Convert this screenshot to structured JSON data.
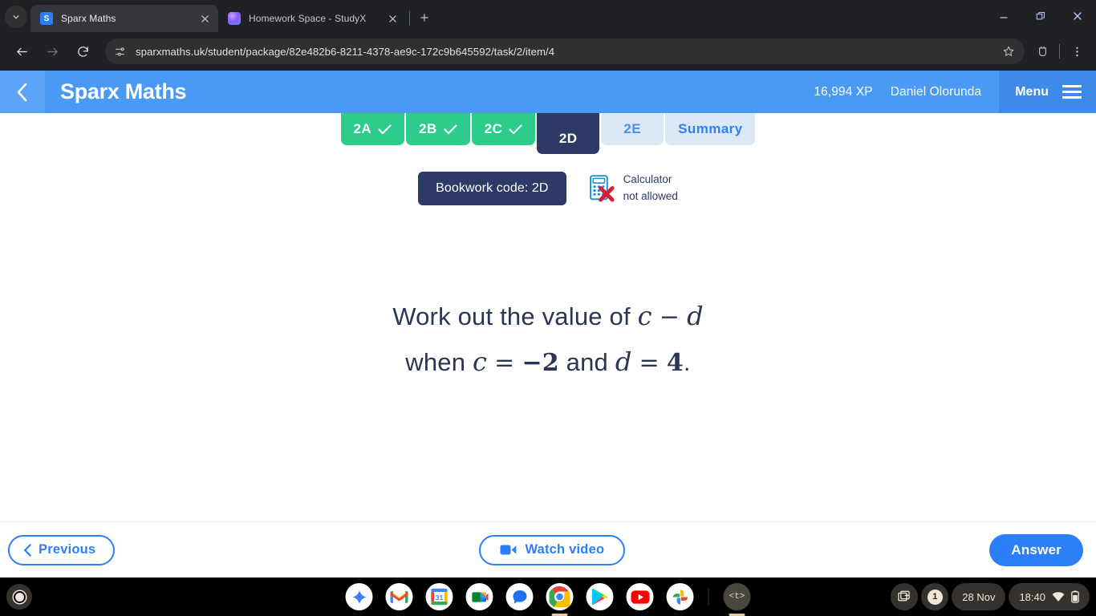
{
  "browser": {
    "tabs": [
      {
        "title": "Sparx Maths",
        "favicon": "sparx-favicon",
        "active": true
      },
      {
        "title": "Homework Space - StudyX",
        "favicon": "studyx-favicon",
        "active": false
      }
    ],
    "newtab_tooltip": "New tab",
    "omnibox": {
      "url": "sparxmaths.uk/student/package/82e482b6-8211-4378-ae9c-172c9b645592/task/2/item/4",
      "site_icon": "site-settings-icon",
      "bookmark_icon": "star-icon",
      "extensions_icon": "extensions-icon",
      "menu_icon": "three-dot-menu-icon"
    },
    "nav": {
      "back_icon": "arrow-back-icon",
      "forward_icon": "arrow-forward-icon",
      "reload_icon": "reload-icon"
    },
    "window_controls": {
      "minimize": "minimize-icon",
      "maximize": "maximize-icon",
      "close": "close-icon"
    }
  },
  "app_header": {
    "back_icon": "chevron-left-icon",
    "logo": "Sparx Maths",
    "xp": "16,994 XP",
    "user": "Daniel Olorunda",
    "menu_label": "Menu",
    "menu_icon": "hamburger-icon"
  },
  "task_tabs": [
    {
      "label": "2A",
      "state": "done"
    },
    {
      "label": "2B",
      "state": "done"
    },
    {
      "label": "2C",
      "state": "done"
    },
    {
      "label": "2D",
      "state": "current"
    },
    {
      "label": "2E",
      "state": "todo"
    },
    {
      "label": "Summary",
      "state": "summary"
    }
  ],
  "bookwork": {
    "code_label": "Bookwork code: 2D",
    "calculator_line1": "Calculator",
    "calculator_line2": "not allowed",
    "calculator_icon": "calculator-not-allowed-icon"
  },
  "question": {
    "line1_prefix": "Work out the value of ",
    "line1_var_a": "c",
    "line1_operator": "−",
    "line1_var_b": "d",
    "line2_prefix": "when ",
    "line2_var_a": "c",
    "line2_equals": "=",
    "line2_value_a": "−2",
    "line2_conjunction": " and ",
    "line2_var_b": "d",
    "line2_equals_b": "=",
    "line2_value_b": "4",
    "line2_period": "."
  },
  "footer": {
    "previous_label": "Previous",
    "previous_icon": "chevron-left-icon",
    "watch_video_label": "Watch video",
    "watch_video_icon": "video-camera-icon",
    "answer_label": "Answer"
  },
  "shelf": {
    "launcher_icon": "launcher-icon",
    "apps": [
      {
        "name": "gemini-app-icon",
        "glyph": "✦"
      },
      {
        "name": "gmail-app-icon",
        "glyph": "M"
      },
      {
        "name": "google-calendar-app-icon",
        "glyph": "31"
      },
      {
        "name": "google-meet-app-icon",
        "glyph": "▶"
      },
      {
        "name": "google-messages-app-icon",
        "glyph": "●"
      },
      {
        "name": "google-chrome-app-icon",
        "glyph": "●",
        "running": true
      },
      {
        "name": "google-play-store-app-icon",
        "glyph": "▶"
      },
      {
        "name": "youtube-app-icon",
        "glyph": "▶"
      },
      {
        "name": "google-photos-app-icon",
        "glyph": "✸"
      },
      {
        "name": "text-editor-app-icon",
        "glyph": "<t>",
        "running": true
      }
    ],
    "tray": {
      "screenshot_icon": "screen-capture-icon",
      "notification_count": "1",
      "date": "28 Nov",
      "time": "18:40",
      "wifi_icon": "wifi-icon",
      "battery_icon": "battery-icon"
    }
  },
  "colors": {
    "sparx_blue": "#4a9af5",
    "sparx_navy": "#2e3a66",
    "accent_blue": "#2d7ff9",
    "done_green": "#2ecc8a",
    "todo_light": "#dde8f5"
  }
}
